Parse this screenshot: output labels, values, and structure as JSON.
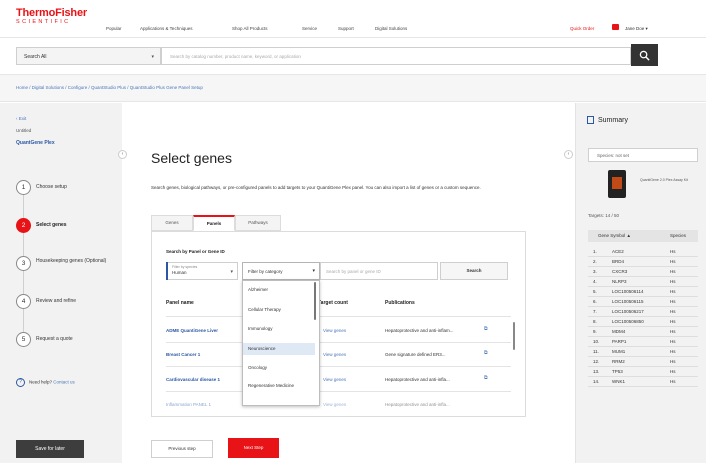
{
  "header": {
    "logo_line1": "ThermoFisher",
    "logo_line2": "SCIENTIFIC",
    "nav": [
      "Popular",
      "Applications & Techniques",
      "Shop All Products",
      "Service",
      "Support",
      "Digital Solutions"
    ],
    "quick_order": "Quick Order",
    "user": "Jane Doe"
  },
  "search": {
    "scope": "Search All",
    "placeholder": "Search by catalog number, product name, keyword, or application"
  },
  "breadcrumb": "Home  /  Digital Solutions  /  Configure  /  QuantStudio Plus  /  QuantStudio Plus Gene Panel Setup",
  "sidebar": {
    "back": "‹ Exit",
    "project": "Untitled",
    "title": "QuantGene Plex",
    "steps": [
      {
        "num": "1",
        "label": "Choose setup"
      },
      {
        "num": "2",
        "label": "Select genes"
      },
      {
        "num": "3",
        "label": "Housekeeping genes (Optional)"
      },
      {
        "num": "4",
        "label": "Review and refine"
      },
      {
        "num": "5",
        "label": "Request a quote"
      }
    ],
    "help_text": "Need help?",
    "help_link": "Contact us",
    "save_label": "Save for later"
  },
  "main": {
    "title": "Select genes",
    "description": "Search genes, biological pathways, or pre-configured panels to add targets to your QuantiGene Plex panel. You can also import a list of genes or a custom sequence.",
    "tabs": [
      "Genes",
      "Panels",
      "Pathways"
    ],
    "search_label": "Search by Panel or Gene ID",
    "species_label": "Filter by species",
    "species_value": "Human",
    "filter_label": "Filter by category",
    "gene_placeholder": "Search by panel or gene ID",
    "search_button": "Search",
    "columns": [
      "Panel name",
      "Target count",
      "Publications"
    ],
    "rows": [
      {
        "name": "ADME QuantiGene Liver",
        "link": "View genes",
        "pub": "Hepatoprotective and anti-inflam..."
      },
      {
        "name": "Breast Cancer 1",
        "link": "View genes",
        "pub": "Gene signature defined ER3..."
      },
      {
        "name": "Cardiovascular disease 1",
        "link": "View genes",
        "pub": "Hepatoprotective and anti-infla..."
      },
      {
        "name": "Inflammation PANEL 1",
        "link": "View genes",
        "pub": "Hepatoprotective and anti-infla..."
      }
    ],
    "dropdown": [
      "Alzheimer",
      "Cellular Therapy",
      "Immunology",
      "Neuroscience",
      "Oncology",
      "Regenerative Medicine"
    ],
    "dropdown_selected": "Neuroscience",
    "prev_label": "Previous step",
    "next_label": "Next Step"
  },
  "summary": {
    "title": "Summary",
    "species": "Species: not set",
    "product_name": "QuantiGene 2.0 Plex Assay Kit",
    "targets": "Targets: 14 / 50",
    "col_gene": "Gene Symbol",
    "col_species": "Species",
    "genes": [
      {
        "n": "1.",
        "g": "ACE2",
        "s": "Hs"
      },
      {
        "n": "2.",
        "g": "BRD4",
        "s": "Hs"
      },
      {
        "n": "3.",
        "g": "CXCR3",
        "s": "Hs"
      },
      {
        "n": "4.",
        "g": "NLRP3",
        "s": "Hs"
      },
      {
        "n": "5.",
        "g": "LOC100506114",
        "s": "Hs"
      },
      {
        "n": "6.",
        "g": "LOC100506115",
        "s": "Hs"
      },
      {
        "n": "7.",
        "g": "LOC100506217",
        "s": "Hs"
      },
      {
        "n": "8.",
        "g": "LOC100506850",
        "s": "Hs"
      },
      {
        "n": "9.",
        "g": "MDM4",
        "s": "Hs"
      },
      {
        "n": "10.",
        "g": "PARP1",
        "s": "Hs"
      },
      {
        "n": "11.",
        "g": "MUM1",
        "s": "Hs"
      },
      {
        "n": "12.",
        "g": "RRM2",
        "s": "Hs"
      },
      {
        "n": "13.",
        "g": "TP53",
        "s": "Hs"
      },
      {
        "n": "14.",
        "g": "WNK1",
        "s": "Hs"
      }
    ]
  }
}
